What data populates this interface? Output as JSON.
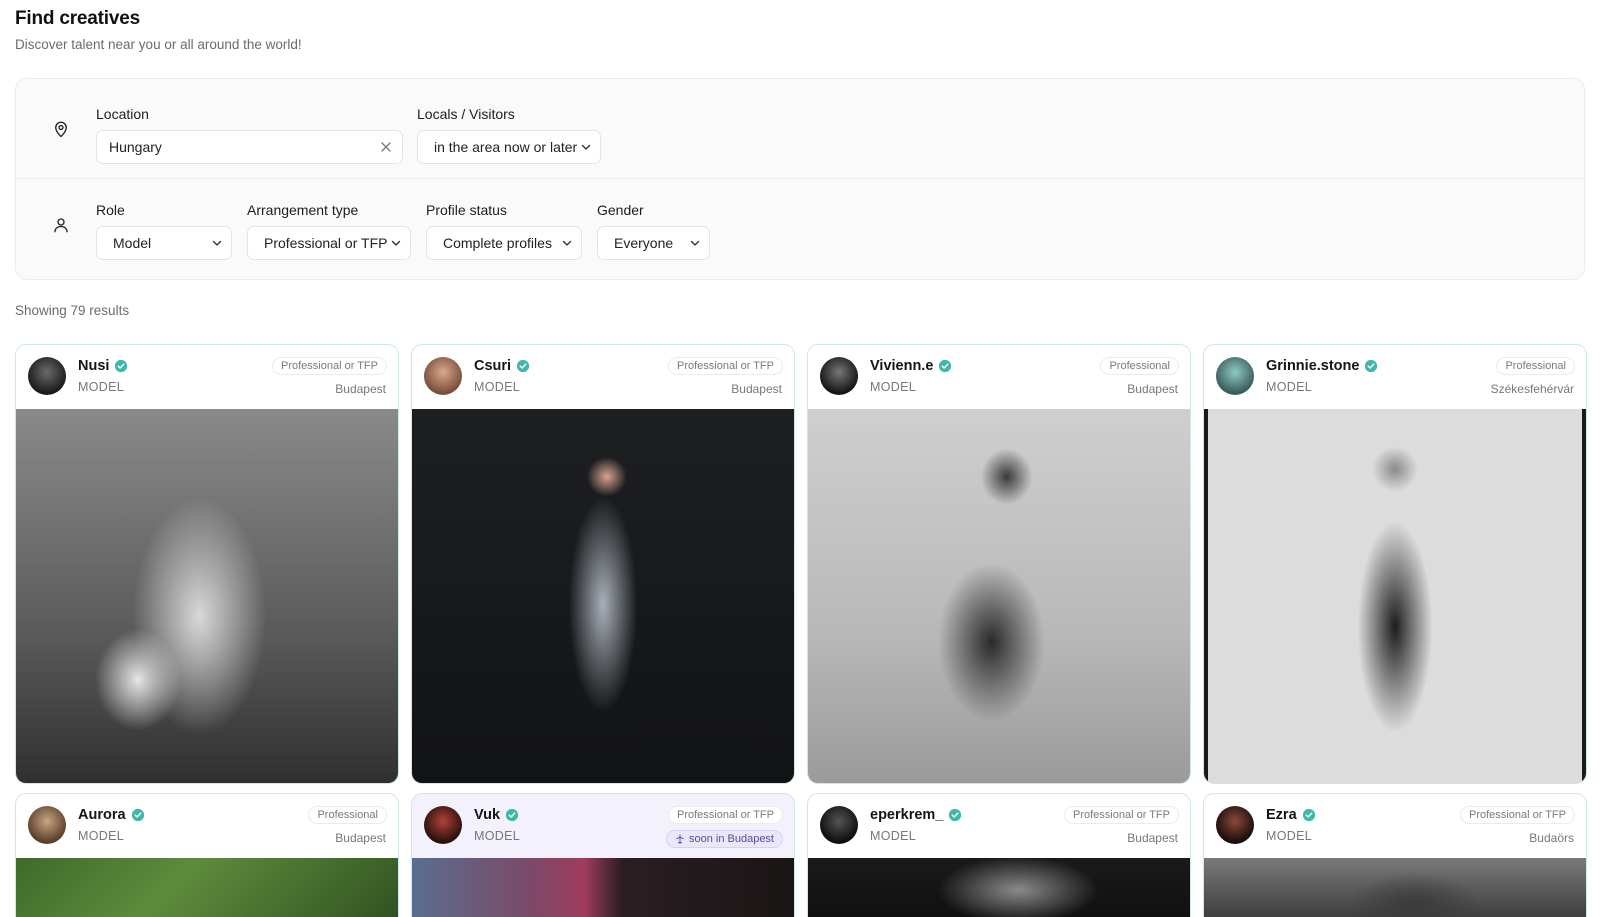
{
  "header": {
    "title": "Find creatives",
    "subtitle": "Discover talent near you or all around the world!"
  },
  "filters": {
    "location": {
      "label": "Location",
      "value": "Hungary"
    },
    "locals": {
      "label": "Locals / Visitors",
      "value": "in the area now or later"
    },
    "role": {
      "label": "Role",
      "value": "Model"
    },
    "arrangement": {
      "label": "Arrangement type",
      "value": "Professional or TFP"
    },
    "status": {
      "label": "Profile status",
      "value": "Complete profiles"
    },
    "gender": {
      "label": "Gender",
      "value": "Everyone"
    }
  },
  "results": {
    "text": "Showing 79 results"
  },
  "colors": {
    "accent": "#3fb8a8",
    "card_border": "#cfe7e4",
    "soon_bg": "#ebe7fb"
  },
  "cards": [
    {
      "name": "Nusi",
      "role": "MODEL",
      "arrangement": "Professional or TFP",
      "city": "Budapest"
    },
    {
      "name": "Csuri",
      "role": "MODEL",
      "arrangement": "Professional or TFP",
      "city": "Budapest"
    },
    {
      "name": "Vivienn.e",
      "role": "MODEL",
      "arrangement": "Professional",
      "city": "Budapest"
    },
    {
      "name": "Grinnie.stone",
      "role": "MODEL",
      "arrangement": "Professional",
      "city": "Székesfehérvár"
    },
    {
      "name": "Aurora",
      "role": "MODEL",
      "arrangement": "Professional",
      "city": "Budapest"
    },
    {
      "name": "Vuk",
      "role": "MODEL",
      "arrangement": "Professional or TFP",
      "city": "soon in Budapest"
    },
    {
      "name": "eperkrem_",
      "role": "MODEL",
      "arrangement": "Professional or TFP",
      "city": "Budapest"
    },
    {
      "name": "Ezra",
      "role": "MODEL",
      "arrangement": "Professional or TFP",
      "city": "Budaörs"
    }
  ]
}
